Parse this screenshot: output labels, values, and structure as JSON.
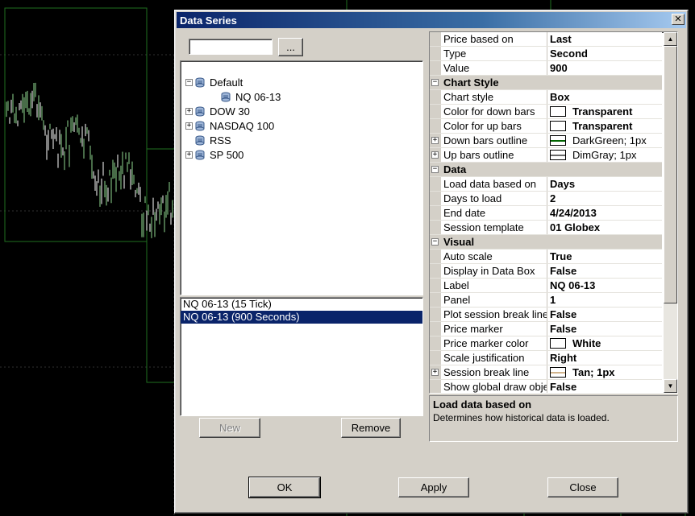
{
  "dialog": {
    "title": "Data Series",
    "close_glyph": "✕",
    "search_value": "",
    "browse_label": "...",
    "buttons": {
      "new": "New",
      "remove": "Remove",
      "ok": "OK",
      "apply": "Apply",
      "close": "Close"
    }
  },
  "tree": [
    {
      "label": "Default",
      "expander": "−",
      "icon": "database-icon",
      "indent": 0
    },
    {
      "label": "NQ 06-13",
      "expander": "",
      "icon": "instrument-icon",
      "indent": 1
    },
    {
      "label": "DOW 30",
      "expander": "+",
      "icon": "database-icon",
      "indent": 0
    },
    {
      "label": "NASDAQ 100",
      "expander": "+",
      "icon": "database-icon",
      "indent": 0
    },
    {
      "label": "RSS",
      "expander": "",
      "icon": "database-icon",
      "indent": 0
    },
    {
      "label": "SP 500",
      "expander": "+",
      "icon": "database-icon",
      "indent": 0
    }
  ],
  "series": [
    {
      "label": "NQ 06-13 (15 Tick)",
      "selected": false
    },
    {
      "label": "NQ 06-13 (900 Seconds)",
      "selected": true
    }
  ],
  "properties": [
    {
      "kind": "prop",
      "name": "Price based on",
      "value": "Last"
    },
    {
      "kind": "prop",
      "name": "Type",
      "value": "Second"
    },
    {
      "kind": "prop",
      "name": "Value",
      "value": "900"
    },
    {
      "kind": "cat",
      "name": "Chart Style"
    },
    {
      "kind": "prop",
      "name": "Chart style",
      "value": "Box"
    },
    {
      "kind": "prop",
      "name": "Color for down bars",
      "value": "Transparent",
      "swatch": "#ffffff"
    },
    {
      "kind": "prop",
      "name": "Color for up bars",
      "value": "Transparent",
      "swatch": "#ffffff"
    },
    {
      "kind": "prop",
      "name": "Down bars outline",
      "value": "DarkGreen; 1px",
      "swatch": "line:#006400",
      "expandable": true,
      "light": true
    },
    {
      "kind": "prop",
      "name": "Up bars outline",
      "value": "DimGray; 1px",
      "swatch": "line:#696969",
      "expandable": true,
      "light": true
    },
    {
      "kind": "cat",
      "name": "Data"
    },
    {
      "kind": "prop",
      "name": "Load data based on",
      "value": "Days"
    },
    {
      "kind": "prop",
      "name": "Days to load",
      "value": "2"
    },
    {
      "kind": "prop",
      "name": "End date",
      "value": "4/24/2013"
    },
    {
      "kind": "prop",
      "name": "Session template",
      "value": "01 Globex"
    },
    {
      "kind": "cat",
      "name": "Visual"
    },
    {
      "kind": "prop",
      "name": "Auto scale",
      "value": "True"
    },
    {
      "kind": "prop",
      "name": "Display in Data Box",
      "value": "False"
    },
    {
      "kind": "prop",
      "name": "Label",
      "value": "NQ 06-13"
    },
    {
      "kind": "prop",
      "name": "Panel",
      "value": "1"
    },
    {
      "kind": "prop",
      "name": "Plot session break line",
      "value": "False"
    },
    {
      "kind": "prop",
      "name": "Price marker",
      "value": "False"
    },
    {
      "kind": "prop",
      "name": "Price marker color",
      "value": "White",
      "swatch": "#ffffff"
    },
    {
      "kind": "prop",
      "name": "Scale justification",
      "value": "Right"
    },
    {
      "kind": "prop",
      "name": "Session break line",
      "value": "Tan; 1px",
      "swatch": "line:#d2b48c",
      "expandable": true
    },
    {
      "kind": "prop",
      "name": "Show global draw objects",
      "value": "False"
    }
  ],
  "description": {
    "title": "Load data based on",
    "text": "Determines how historical data is loaded."
  },
  "colors": {
    "chart_background": "#000000",
    "selection": "#0a246a",
    "dialog_face": "#d4d0c8"
  }
}
